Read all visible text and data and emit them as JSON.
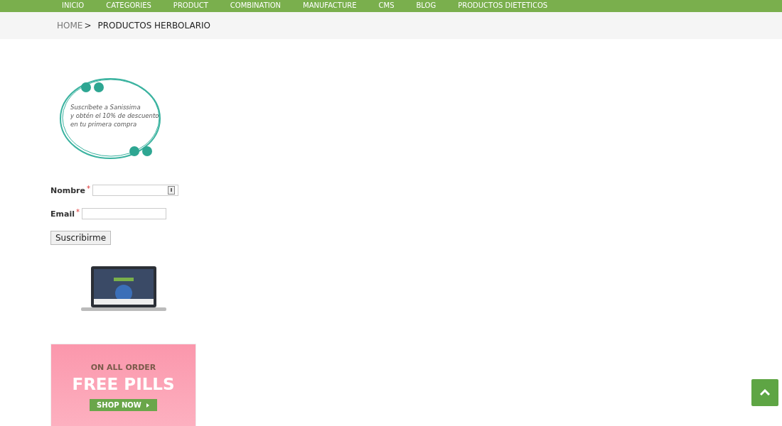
{
  "nav": {
    "items": [
      "INICIO",
      "CATEGORIES",
      "PRODUCT",
      "COMBINATION",
      "MANUFACTURE",
      "CMS",
      "BLOG",
      "PRODUCTOS DIETETICOS"
    ]
  },
  "breadcrumb": {
    "home": "HOME",
    "separator": ">",
    "current": "PRODUCTOS HERBOLARIO"
  },
  "subscribe_banner": {
    "lines": [
      "Suscríbete a Sanissima",
      "y obtén el 10% de descuento",
      "en tu primera compra"
    ]
  },
  "form": {
    "fields": [
      {
        "label": "Nombre",
        "required_mark": "*",
        "kind": "contact"
      },
      {
        "label": "Email",
        "required_mark": "*",
        "kind": "plain"
      }
    ],
    "submit": "Suscribirme"
  },
  "promo": {
    "kicker": "ON ALL ORDER",
    "headline": "FREE PILLS",
    "button": "SHOP NOW"
  }
}
